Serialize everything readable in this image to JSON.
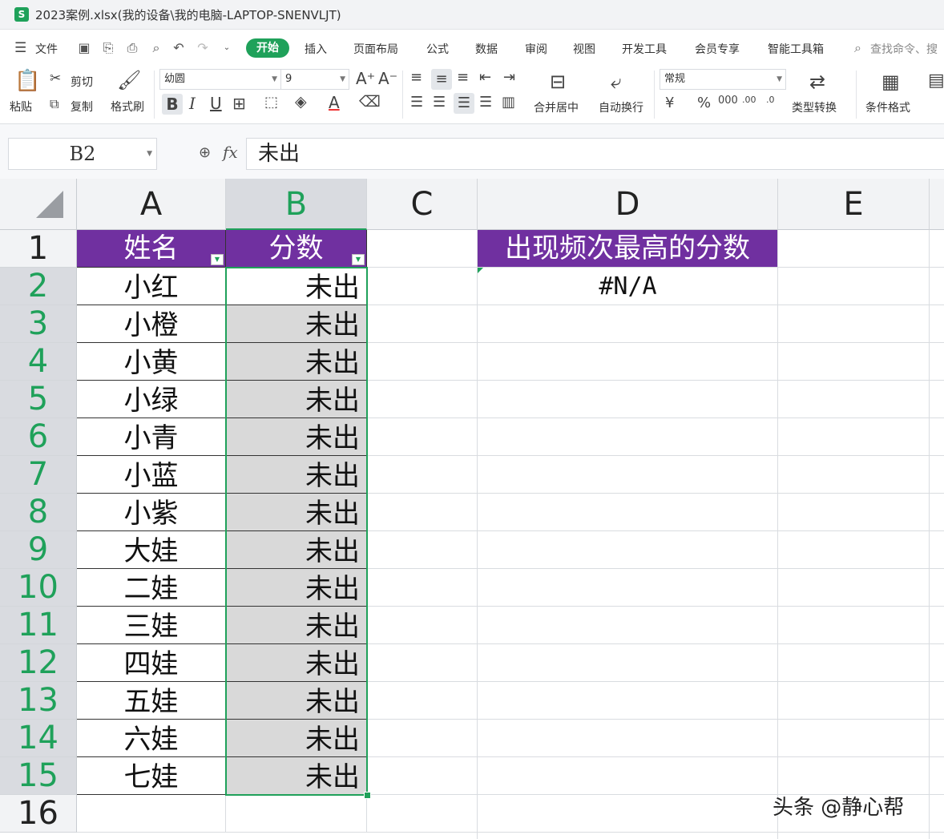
{
  "window": {
    "title": "2023案例.xlsx(我的设备\\我的电脑-LAPTOP-SNENVLJT)",
    "logo": "S"
  },
  "menu": {
    "file_label": "文件",
    "tabs": [
      "开始",
      "插入",
      "页面布局",
      "公式",
      "数据",
      "审阅",
      "视图",
      "开发工具",
      "会员专享",
      "智能工具箱"
    ],
    "active_tab": "开始",
    "search_placeholder": "查找命令、搜"
  },
  "ribbon": {
    "paste": "粘贴",
    "cut": "剪切",
    "copy": "复制",
    "format_painter": "格式刷",
    "font_name": "幼圆",
    "font_size": "9",
    "merge_center": "合并居中",
    "wrap_text": "自动换行",
    "number_format": "常规",
    "type_convert": "类型转换",
    "conditional_format": "条件格式"
  },
  "formula_bar": {
    "name_box": "B2",
    "fx": "fx",
    "content": "未出"
  },
  "sheet": {
    "columns": [
      "A",
      "B",
      "C",
      "D",
      "E"
    ],
    "selected_column": "B",
    "rows": [
      "1",
      "2",
      "3",
      "4",
      "5",
      "6",
      "7",
      "8",
      "9",
      "10",
      "11",
      "12",
      "13",
      "14",
      "15",
      "16"
    ],
    "header": {
      "name": "姓名",
      "score": "分数",
      "result_title": "出现频次最高的分数"
    },
    "names": [
      "小红",
      "小橙",
      "小黄",
      "小绿",
      "小青",
      "小蓝",
      "小紫",
      "大娃",
      "二娃",
      "三娃",
      "四娃",
      "五娃",
      "六娃",
      "七娃"
    ],
    "scores": [
      "未出",
      "未出",
      "未出",
      "未出",
      "未出",
      "未出",
      "未出",
      "未出",
      "未出",
      "未出",
      "未出",
      "未出",
      "未出",
      "未出"
    ],
    "result_value": "#N/A",
    "header_fill": "#7030a0",
    "accent": "#1fa15a"
  },
  "watermark": "头条 @静心帮"
}
